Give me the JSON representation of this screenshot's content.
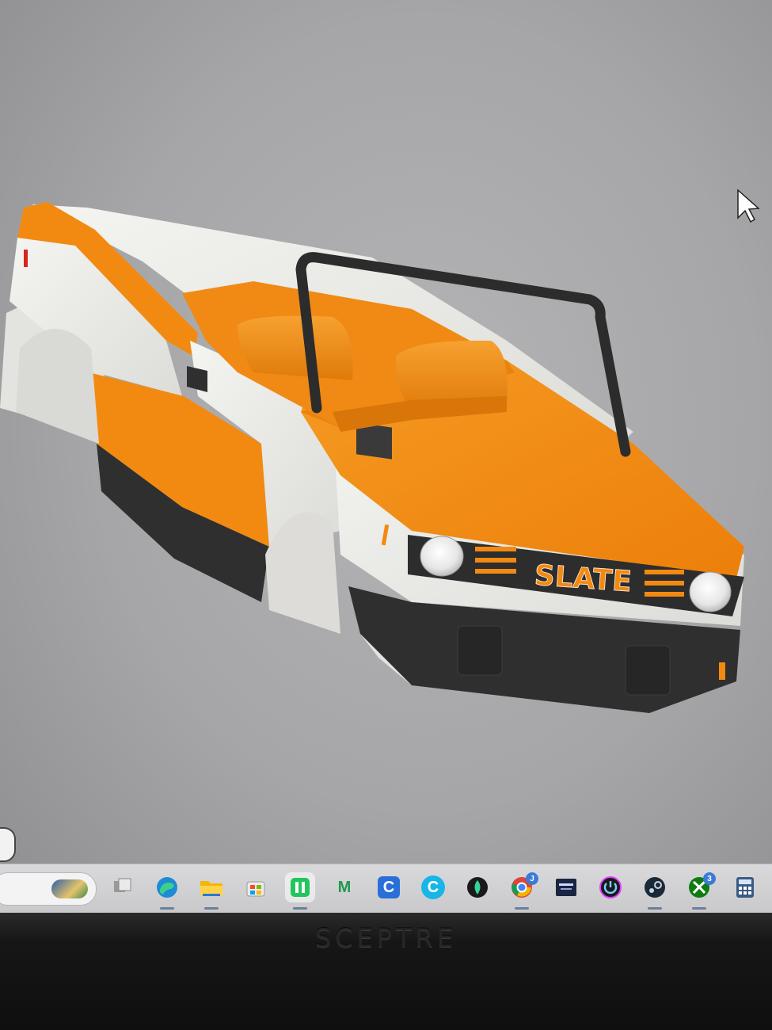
{
  "viewport": {
    "model_brand_text": "SLATE",
    "colors": {
      "background": "#a9a9ab",
      "body_orange": "#f28a12",
      "body_white": "#eeeeea",
      "trim_dark": "#2e2e2e"
    }
  },
  "taskbar": {
    "search_field": {
      "placeholder": ""
    },
    "apps": [
      {
        "name": "task-view-icon",
        "label": ""
      },
      {
        "name": "edge-icon",
        "label": ""
      },
      {
        "name": "file-explorer-icon",
        "label": ""
      },
      {
        "name": "microsoft-store-icon",
        "label": ""
      },
      {
        "name": "green-app-icon",
        "label": ""
      },
      {
        "name": "m-app-icon",
        "label": "M"
      },
      {
        "name": "c-blue-app-icon",
        "label": "C"
      },
      {
        "name": "c-cyan-app-icon",
        "label": "C"
      },
      {
        "name": "drop-app-icon",
        "label": ""
      },
      {
        "name": "chrome-icon",
        "label": "",
        "badge": "J"
      },
      {
        "name": "game-app-icon",
        "label": ""
      },
      {
        "name": "power-app-icon",
        "label": ""
      },
      {
        "name": "steam-icon",
        "label": ""
      },
      {
        "name": "xbox-icon",
        "label": "",
        "badge": "3"
      },
      {
        "name": "calculator-icon",
        "label": ""
      }
    ]
  },
  "monitor": {
    "brand": "SCEPTRE"
  }
}
